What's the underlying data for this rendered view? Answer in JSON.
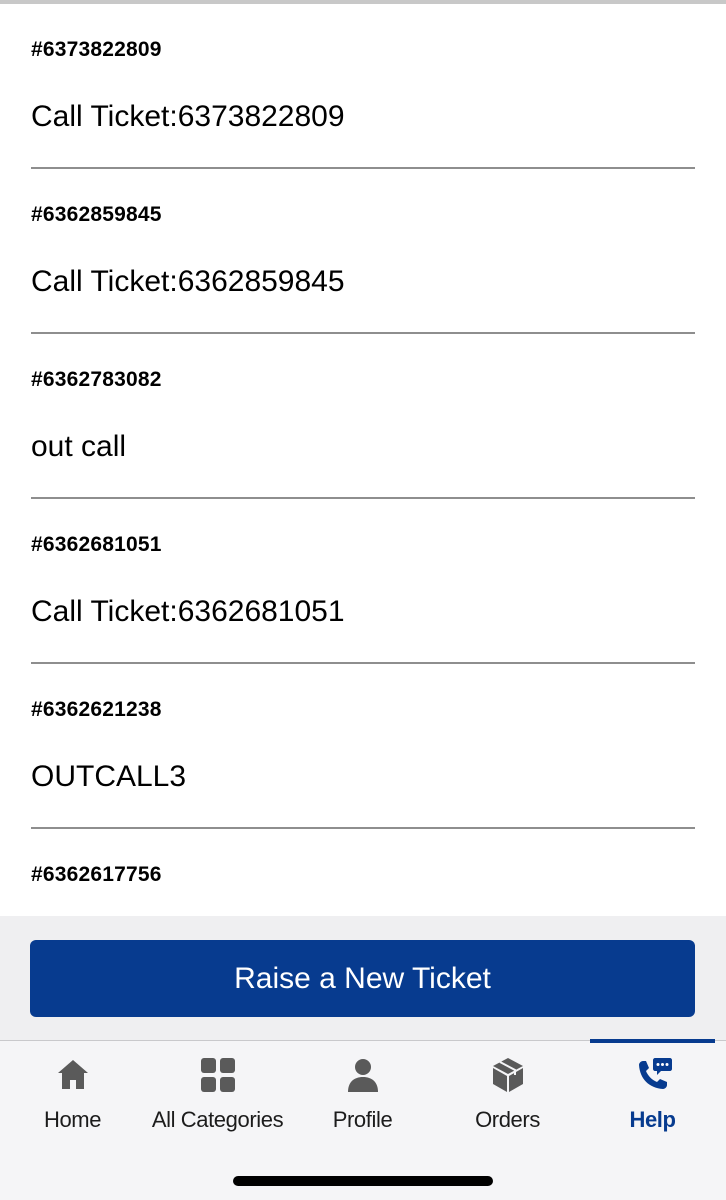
{
  "tickets": [
    {
      "id": "#6373822809",
      "subject": "Call Ticket:6373822809"
    },
    {
      "id": "#6362859845",
      "subject": "Call Ticket:6362859845"
    },
    {
      "id": "#6362783082",
      "subject": "out call"
    },
    {
      "id": "#6362681051",
      "subject": "Call Ticket:6362681051"
    },
    {
      "id": "#6362621238",
      "subject": "OUTCALL3"
    },
    {
      "id": "#6362617756",
      "subject": ""
    }
  ],
  "actions": {
    "raise_ticket_label": "Raise a New Ticket"
  },
  "tab_bar": {
    "tabs": [
      {
        "label": "Home",
        "icon": "home-icon"
      },
      {
        "label": "All Categories",
        "icon": "categories-grid-icon"
      },
      {
        "label": "Profile",
        "icon": "person-icon"
      },
      {
        "label": "Orders",
        "icon": "package-box-icon"
      },
      {
        "label": "Help",
        "icon": "phone-chat-icon"
      }
    ],
    "active": "Help"
  },
  "colors": {
    "brand": "#073b8f",
    "tab_icon": "#5a5a5a",
    "divider": "#8e8e8e"
  }
}
